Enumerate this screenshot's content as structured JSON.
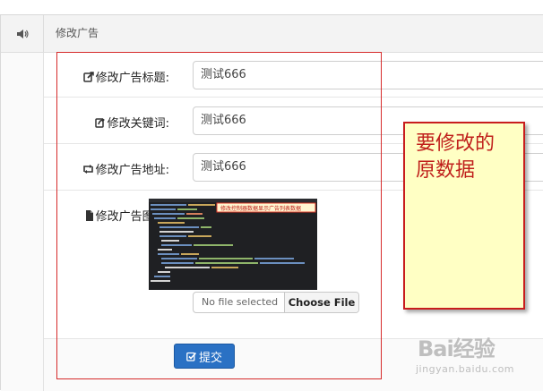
{
  "header": {
    "title": "修改广告"
  },
  "form": {
    "fields": [
      {
        "label": "修改广告标题:",
        "value": "测试666"
      },
      {
        "label": "修改关键词:",
        "value": "测试666"
      },
      {
        "label": "修改广告地址:",
        "value": "测试666"
      }
    ],
    "image_label": "修改广告图片:",
    "thumbnail_caption": "修改控制器数据显示广告列表数据",
    "file_status": "No file selected",
    "file_button": "Choose File",
    "submit_label": "提交"
  },
  "annotation": {
    "line1": "要修改的",
    "line2": "原数据"
  },
  "watermark": {
    "main": "Bai经验",
    "sub": "jingyan.baidu.com"
  },
  "colors": {
    "accent_blue": "#2a71c4",
    "annotation_red": "#c81d1d",
    "note_fill": "#ffffc4"
  }
}
